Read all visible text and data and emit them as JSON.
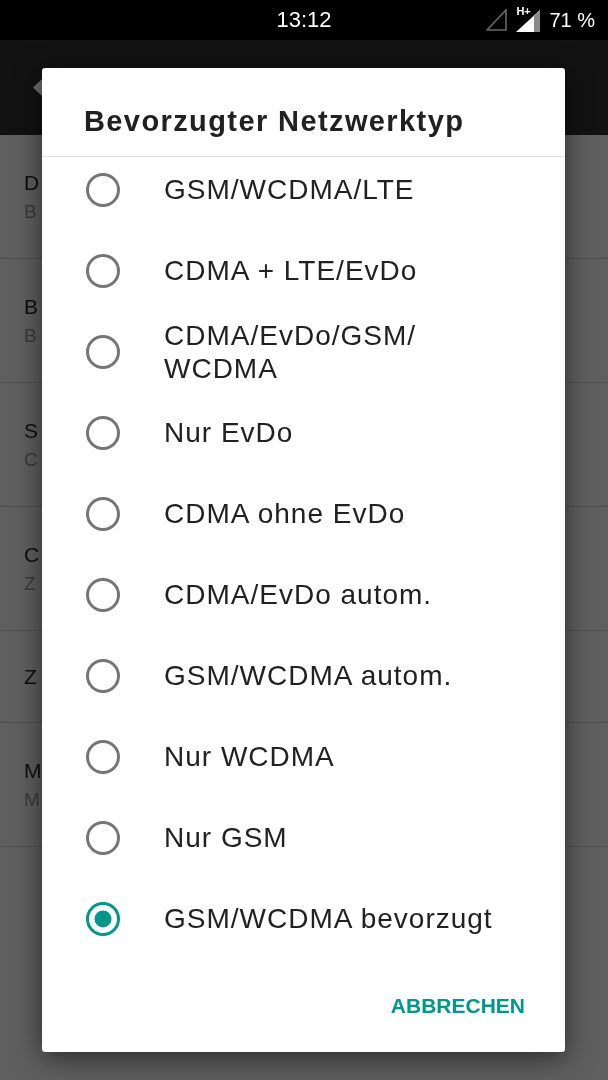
{
  "status_bar": {
    "time": "13:12",
    "network_type": "H+",
    "battery": "71 %"
  },
  "settings_list": [
    {
      "title": "D",
      "subtitle": "B"
    },
    {
      "title": "B",
      "subtitle": "B"
    },
    {
      "title": "S",
      "subtitle": "C"
    },
    {
      "title": "C",
      "subtitle": "Z"
    },
    {
      "title": "Z"
    },
    {
      "title": "M",
      "subtitle": "M"
    }
  ],
  "dialog": {
    "title": "Bevorzugter Netzwerktyp",
    "options": [
      {
        "label": "GSM/WCDMA/LTE",
        "selected": false
      },
      {
        "label": "CDMA + LTE/EvDo",
        "selected": false
      },
      {
        "label": "CDMA/EvDo/GSM/WCDMA",
        "selected": false
      },
      {
        "label": "Nur EvDo",
        "selected": false
      },
      {
        "label": "CDMA ohne EvDo",
        "selected": false
      },
      {
        "label": "CDMA/EvDo autom.",
        "selected": false
      },
      {
        "label": "GSM/WCDMA autom.",
        "selected": false
      },
      {
        "label": "Nur WCDMA",
        "selected": false
      },
      {
        "label": "Nur GSM",
        "selected": false
      },
      {
        "label": "GSM/WCDMA bevorzugt",
        "selected": true
      }
    ],
    "buttons": [
      "ABBRECHEN"
    ]
  }
}
